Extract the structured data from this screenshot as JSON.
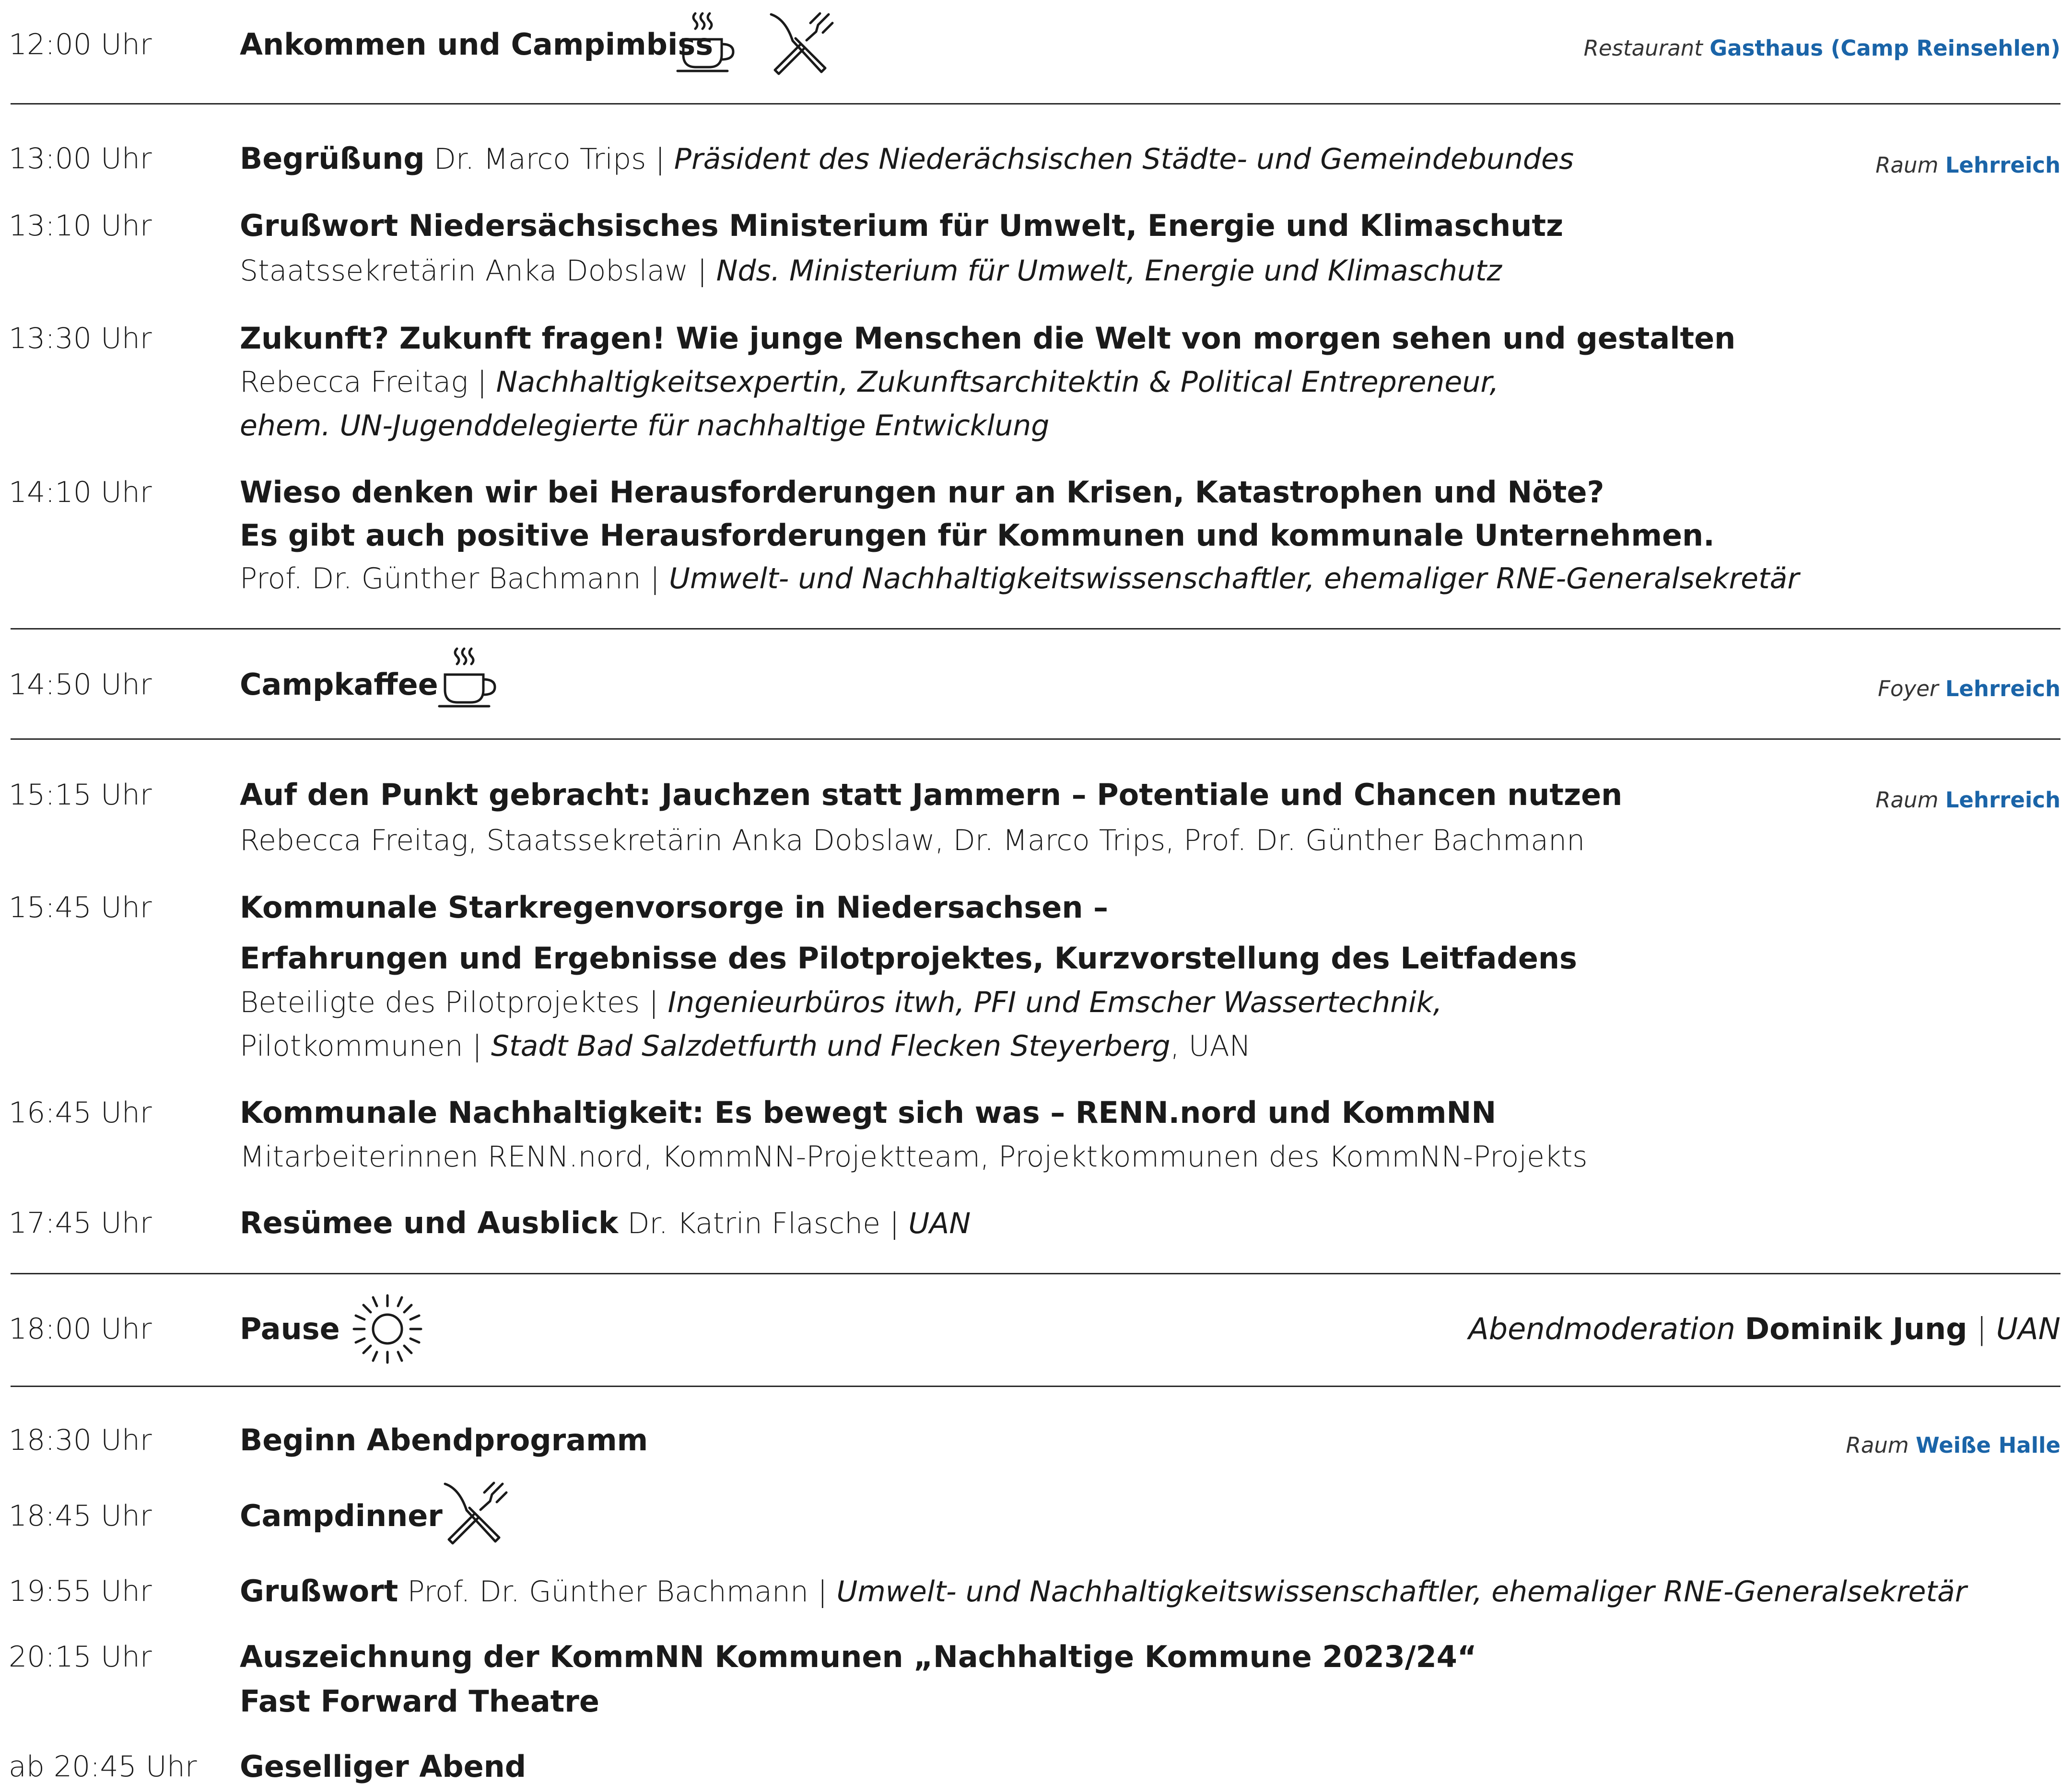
{
  "rows": [
    {
      "time": "12:00 Uhr",
      "title": "Ankommen und Campimbiss",
      "loc_label": "Restaurant",
      "loc_place": "Gasthaus (Camp Reinsehlen)",
      "icons": [
        "coffee-cup-icon",
        "cutlery-icon"
      ]
    },
    {
      "time": "13:00 Uhr",
      "title": "Begrüßung",
      "speaker": "Dr. Marco Trips",
      "role": "Präsident des Niederächsischen Städte- und Gemeindebundes",
      "loc_label": "Raum",
      "loc_place": "Lehrreich"
    },
    {
      "time": "13:10 Uhr",
      "title": "Grußwort Niedersächsisches Ministerium für Umwelt, Energie und Klimaschutz",
      "speaker": "Staatssekretärin Anka Dobslaw",
      "role": "Nds. Ministerium für Umwelt, Energie und Klimaschutz"
    },
    {
      "time": "13:30 Uhr",
      "title": "Zukunft? Zukunft fragen! Wie junge Menschen die Welt von morgen sehen und gestalten",
      "speaker": "Rebecca Freitag",
      "role": "Nachhaltigkeitsexpertin, Zukunftsarchitektin & Political Entrepreneur,",
      "role2": "ehem. UN-Jugenddelegierte für nachhaltige Entwicklung"
    },
    {
      "time": "14:10 Uhr",
      "title": "Wieso denken wir bei Herausforderungen nur an Krisen, Katastrophen und Nöte?",
      "title2": "Es gibt auch positive Herausforderungen für Kommunen und kommunale Unternehmen.",
      "speaker": "Prof. Dr. Günther Bachmann",
      "role": "Umwelt- und Nachhaltigkeitswissenschaftler, ehemaliger RNE-Generalsekretär"
    },
    {
      "time": "14:50 Uhr",
      "title": "Campkaffee",
      "loc_label": "Foyer",
      "loc_place": "Lehrreich",
      "icons": [
        "coffee-cup-icon"
      ]
    },
    {
      "time": "15:15 Uhr",
      "title": "Auf den Punkt gebracht: Jauchzen statt Jammern – Potentiale und Chancen nutzen",
      "speakers": "Rebecca Freitag, Staatssekretärin Anka Dobslaw, Dr. Marco Trips, Prof. Dr. Günther Bachmann",
      "loc_label": "Raum",
      "loc_place": "Lehrreich"
    },
    {
      "time": "15:45 Uhr",
      "title": "Kommunale Starkregenvorsorge in Niedersachsen –",
      "title2": "Erfahrungen und Ergebnisse des Pilotprojektes, Kurzvorstellung des Leitfadens",
      "speaker": "Beteiligte des Pilotprojektes",
      "role": "Ingenieurbüros itwh, PFI und Emscher Wassertechnik,",
      "speaker2": "Pilotkommunen",
      "role2": "Stadt Bad Salzdetfurth und Flecken Steyerberg",
      "extra2": ", UAN"
    },
    {
      "time": "16:45 Uhr",
      "title": "Kommunale Nachhaltigkeit: Es bewegt sich was – RENN.nord und KommNN",
      "speakers": "Mitarbeiterinnen RENN.nord, KommNN-Projektteam, Projektkommunen des KommNN-Projekts"
    },
    {
      "time": "17:45 Uhr",
      "title": "Resümee und Ausblick",
      "speaker": "Dr. Katrin Flasche",
      "role": "UAN"
    },
    {
      "time": "18:00 Uhr",
      "title": "Pause",
      "mod_label": "Abendmoderation",
      "mod_name": "Dominik Jung",
      "mod_org": "UAN",
      "icons": [
        "sun-icon"
      ]
    },
    {
      "time": "18:30 Uhr",
      "title": "Beginn Abendprogramm",
      "loc_label": "Raum",
      "loc_place": "Weiße Halle"
    },
    {
      "time": "18:45 Uhr",
      "title": "Campdinner",
      "icons": [
        "cutlery-icon"
      ]
    },
    {
      "time": "19:55 Uhr",
      "title": "Grußwort",
      "speaker": "Prof. Dr. Günther Bachmann",
      "role": "Umwelt- und Nachhaltigkeitswissenschaftler, ehemaliger RNE-Generalsekretär"
    },
    {
      "time": "20:15 Uhr",
      "title": "Auszeichnung der KommNN Kommunen „Nachhaltige Kommune 2023/24“",
      "title2": "Fast Forward Theatre"
    },
    {
      "time": "ab 20:45 Uhr",
      "title": "Geselliger Abend"
    }
  ],
  "separator": " | ",
  "colors": {
    "text": "#1a1a1a",
    "accent": "#1a64a8",
    "rule": "#2a2a2a"
  }
}
